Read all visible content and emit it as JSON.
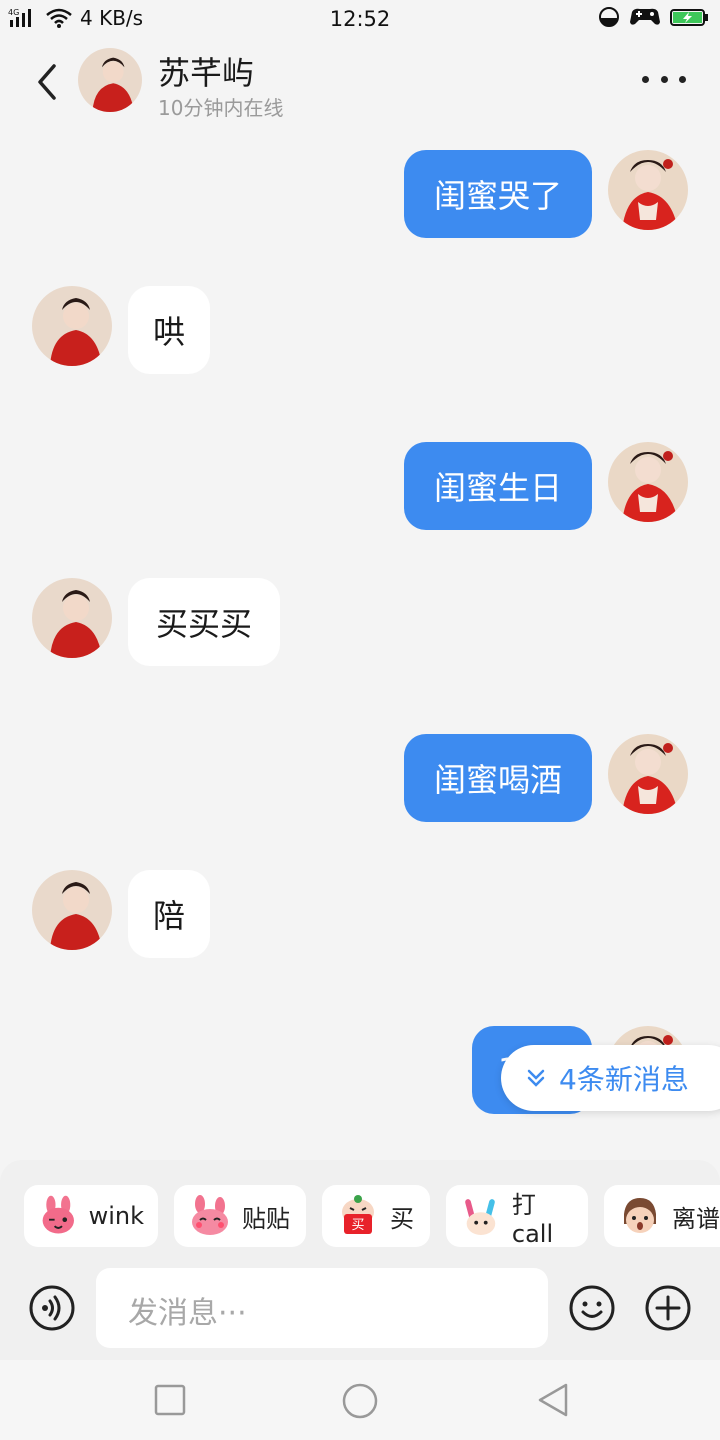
{
  "status_bar": {
    "network_label": "4G",
    "speed": "4 KB/s",
    "time": "12:52"
  },
  "header": {
    "title": "苏芊屿",
    "subtitle": "10分钟内在线"
  },
  "messages": [
    {
      "side": "out",
      "text": "闺蜜哭了"
    },
    {
      "side": "in",
      "text": "哄"
    },
    {
      "side": "out",
      "text": "闺蜜生日"
    },
    {
      "side": "in",
      "text": "买买买"
    },
    {
      "side": "out",
      "text": "闺蜜喝酒"
    },
    {
      "side": "in",
      "text": "陪"
    },
    {
      "side": "out",
      "text": "1"
    }
  ],
  "new_messages_label": "4条新消息",
  "stickers": [
    {
      "label": "wink",
      "icon": "bunny-wink-icon"
    },
    {
      "label": "贴贴",
      "icon": "bunny-hug-icon"
    },
    {
      "label": "买",
      "icon": "buy-bag-icon"
    },
    {
      "label": "打call",
      "icon": "glowstick-icon"
    },
    {
      "label": "离谱",
      "icon": "shocked-face-icon"
    }
  ],
  "input": {
    "placeholder": "发消息···"
  },
  "colors": {
    "accent": "#3d8bf0",
    "background": "#f4f4f4",
    "bubble_in": "#ffffff"
  }
}
